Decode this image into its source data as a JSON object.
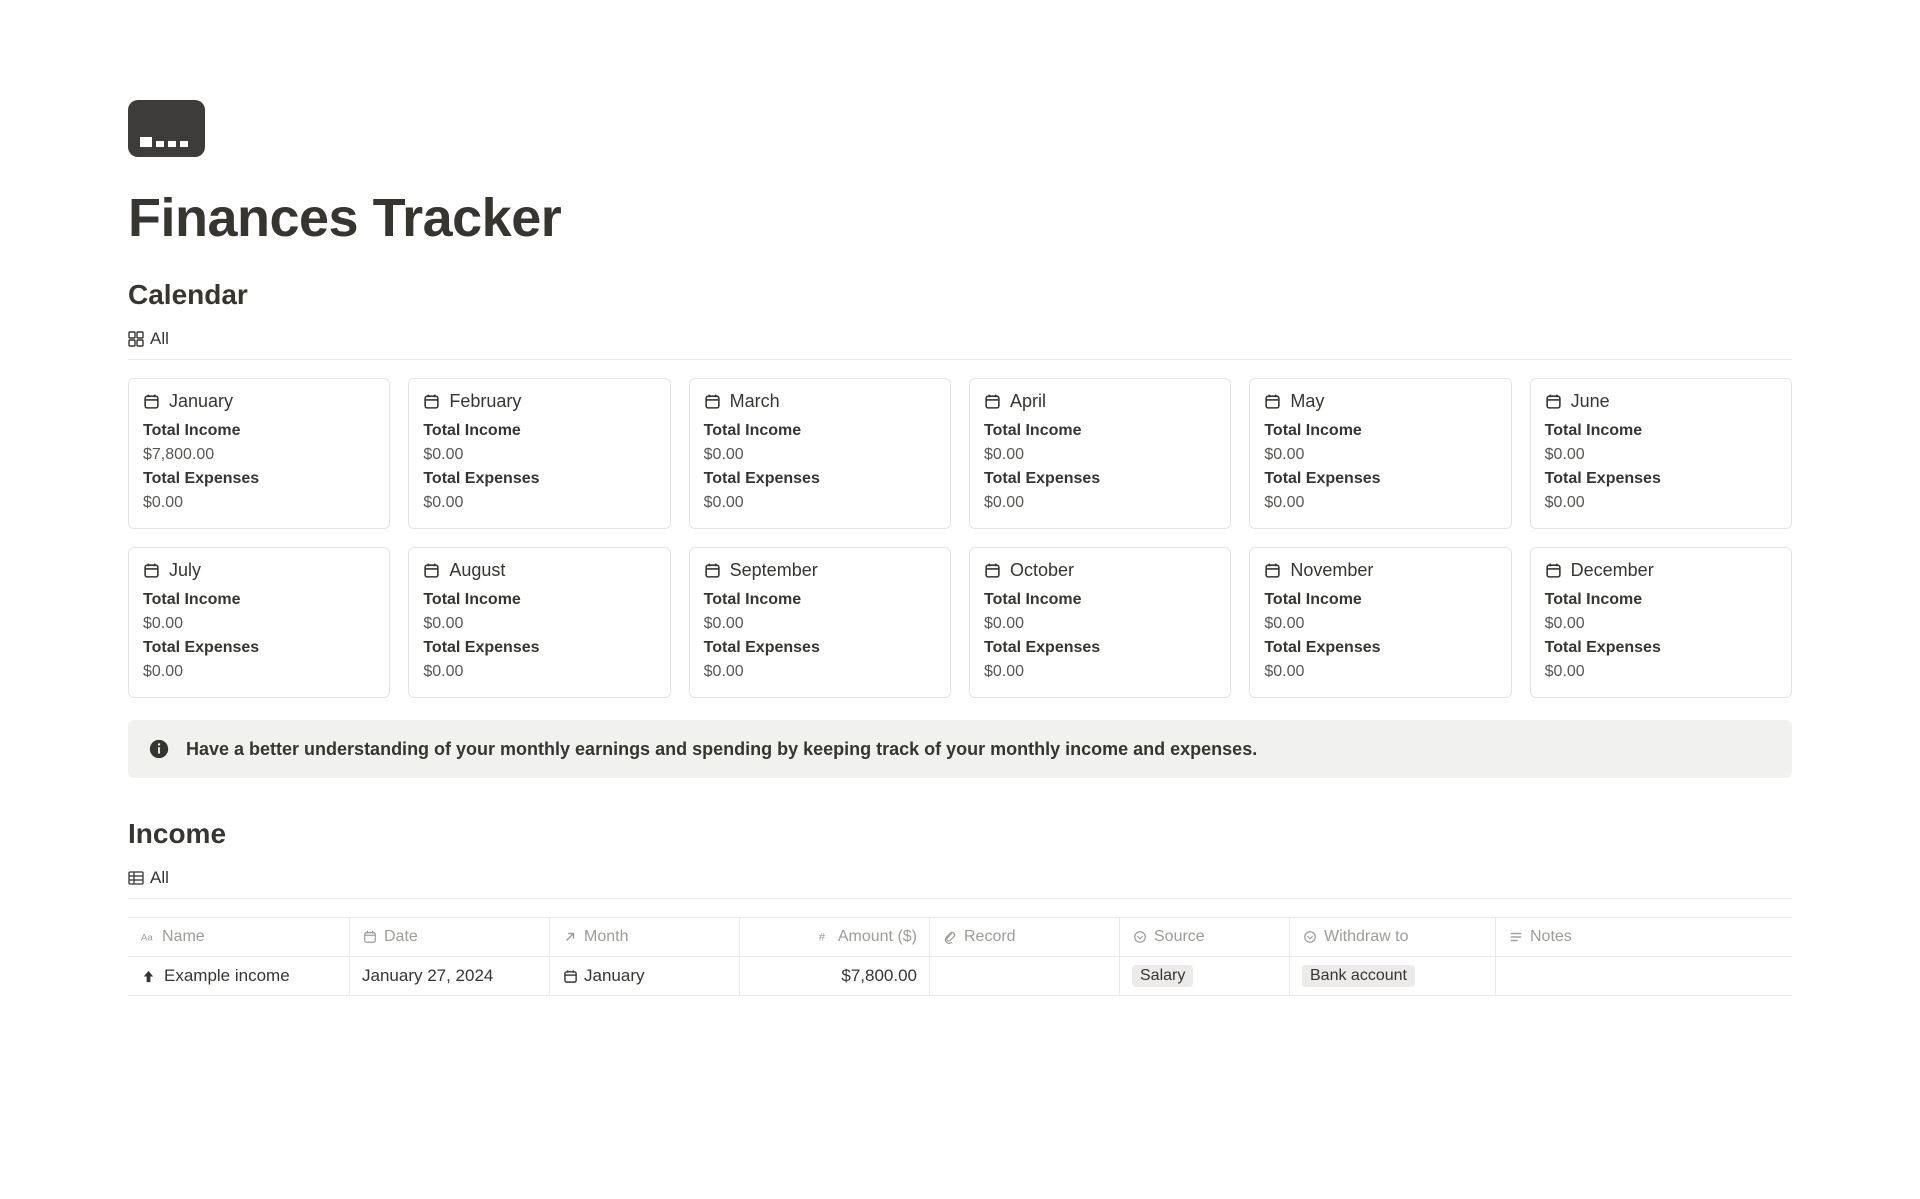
{
  "page_title": "Finances Tracker",
  "calendar": {
    "heading": "Calendar",
    "view_tab": "All",
    "months": [
      {
        "name": "January",
        "income_label": "Total Income",
        "income_value": "$7,800.00",
        "expenses_label": "Total Expenses",
        "expenses_value": "$0.00"
      },
      {
        "name": "February",
        "income_label": "Total Income",
        "income_value": "$0.00",
        "expenses_label": "Total Expenses",
        "expenses_value": "$0.00"
      },
      {
        "name": "March",
        "income_label": "Total Income",
        "income_value": "$0.00",
        "expenses_label": "Total Expenses",
        "expenses_value": "$0.00"
      },
      {
        "name": "April",
        "income_label": "Total Income",
        "income_value": "$0.00",
        "expenses_label": "Total Expenses",
        "expenses_value": "$0.00"
      },
      {
        "name": "May",
        "income_label": "Total Income",
        "income_value": "$0.00",
        "expenses_label": "Total Expenses",
        "expenses_value": "$0.00"
      },
      {
        "name": "June",
        "income_label": "Total Income",
        "income_value": "$0.00",
        "expenses_label": "Total Expenses",
        "expenses_value": "$0.00"
      },
      {
        "name": "July",
        "income_label": "Total Income",
        "income_value": "$0.00",
        "expenses_label": "Total Expenses",
        "expenses_value": "$0.00"
      },
      {
        "name": "August",
        "income_label": "Total Income",
        "income_value": "$0.00",
        "expenses_label": "Total Expenses",
        "expenses_value": "$0.00"
      },
      {
        "name": "September",
        "income_label": "Total Income",
        "income_value": "$0.00",
        "expenses_label": "Total Expenses",
        "expenses_value": "$0.00"
      },
      {
        "name": "October",
        "income_label": "Total Income",
        "income_value": "$0.00",
        "expenses_label": "Total Expenses",
        "expenses_value": "$0.00"
      },
      {
        "name": "November",
        "income_label": "Total Income",
        "income_value": "$0.00",
        "expenses_label": "Total Expenses",
        "expenses_value": "$0.00"
      },
      {
        "name": "December",
        "income_label": "Total Income",
        "income_value": "$0.00",
        "expenses_label": "Total Expenses",
        "expenses_value": "$0.00"
      }
    ]
  },
  "callout": {
    "text": "Have a better understanding of your monthly earnings and spending by keeping track of your monthly income and expenses."
  },
  "income": {
    "heading": "Income",
    "view_tab": "All",
    "columns": {
      "name": "Name",
      "date": "Date",
      "month": "Month",
      "amount": "Amount ($)",
      "record": "Record",
      "source": "Source",
      "withdraw": "Withdraw to",
      "notes": "Notes"
    },
    "rows": [
      {
        "name": "Example income",
        "date": "January 27, 2024",
        "month": "January",
        "amount": "$7,800.00",
        "record": "",
        "source": "Salary",
        "withdraw": "Bank account",
        "notes": ""
      }
    ]
  }
}
